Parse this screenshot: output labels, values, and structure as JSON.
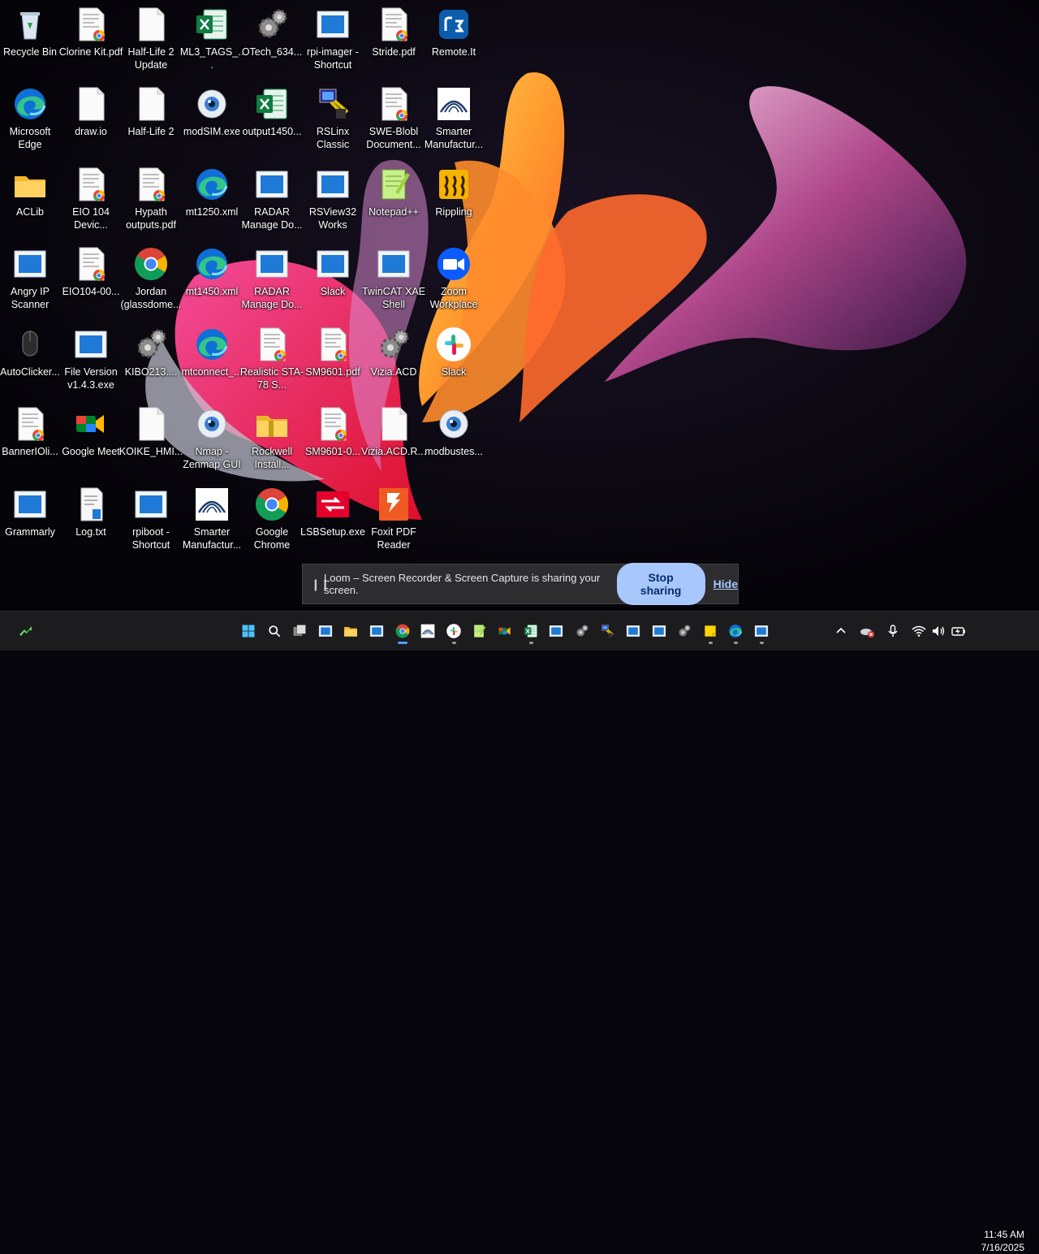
{
  "desktop": {
    "icons": [
      {
        "label": "Recycle Bin",
        "icon": "recycle-bin-icon",
        "col": 0,
        "row": 0
      },
      {
        "label": "Microsoft Edge",
        "icon": "edge-icon",
        "col": 0,
        "row": 1
      },
      {
        "label": "ACLib",
        "icon": "folder-icon",
        "col": 0,
        "row": 2
      },
      {
        "label": "Angry IP Scanner",
        "icon": "app-window-icon",
        "col": 0,
        "row": 3
      },
      {
        "label": "AutoClicker...",
        "icon": "mouse-icon",
        "col": 0,
        "row": 4
      },
      {
        "label": "BannerIOli...",
        "icon": "pdf-chrome-icon",
        "col": 0,
        "row": 5
      },
      {
        "label": "Grammarly",
        "icon": "app-window-icon",
        "col": 0,
        "row": 6
      },
      {
        "label": "Clorine Kit.pdf",
        "icon": "pdf-chrome-icon",
        "col": 1,
        "row": 0
      },
      {
        "label": "draw.io",
        "icon": "blank-file-icon",
        "col": 1,
        "row": 1
      },
      {
        "label": "EIO 104 Devic...",
        "icon": "pdf-chrome-icon",
        "col": 1,
        "row": 2
      },
      {
        "label": "EIO104-00...",
        "icon": "pdf-chrome-icon",
        "col": 1,
        "row": 3
      },
      {
        "label": "File Version v1.4.3.exe",
        "icon": "app-window-icon",
        "col": 1,
        "row": 4
      },
      {
        "label": "Google Meet",
        "icon": "google-meet-icon",
        "col": 1,
        "row": 5
      },
      {
        "label": "Log.txt",
        "icon": "text-file-icon",
        "col": 1,
        "row": 6
      },
      {
        "label": "Half-Life 2 Update",
        "icon": "blank-file-icon",
        "col": 2,
        "row": 0
      },
      {
        "label": "Half-Life 2",
        "icon": "blank-file-icon",
        "col": 2,
        "row": 1
      },
      {
        "label": "Hypath outputs.pdf",
        "icon": "pdf-chrome-icon",
        "col": 2,
        "row": 2
      },
      {
        "label": "Jordan (glassdome...",
        "icon": "chrome-icon",
        "col": 2,
        "row": 3
      },
      {
        "label": "KIBO213....",
        "icon": "gears-icon",
        "col": 2,
        "row": 4
      },
      {
        "label": "KOIKE_HMI...",
        "icon": "blank-file-icon",
        "col": 2,
        "row": 5
      },
      {
        "label": "rpiboot - Shortcut",
        "icon": "app-window-icon",
        "col": 2,
        "row": 6
      },
      {
        "label": "ML3_TAGS_...",
        "icon": "excel-icon",
        "col": 3,
        "row": 0
      },
      {
        "label": "modSIM.exe",
        "icon": "eye-icon",
        "col": 3,
        "row": 1
      },
      {
        "label": "mt1250.xml",
        "icon": "edge-icon",
        "col": 3,
        "row": 2
      },
      {
        "label": "mt1450.xml",
        "icon": "edge-icon",
        "col": 3,
        "row": 3
      },
      {
        "label": "mtconnect_...",
        "icon": "edge-icon",
        "col": 3,
        "row": 4
      },
      {
        "label": "Nmap - Zenmap GUI",
        "icon": "eye-icon",
        "col": 3,
        "row": 5
      },
      {
        "label": "Smarter Manufactur...",
        "icon": "arch-logo-icon",
        "col": 3,
        "row": 6
      },
      {
        "label": "OTech_634...",
        "icon": "gears-icon",
        "col": 4,
        "row": 0
      },
      {
        "label": "output1450...",
        "icon": "excel-icon",
        "col": 4,
        "row": 1
      },
      {
        "label": "RADAR Manage Do...",
        "icon": "app-window-icon",
        "col": 4,
        "row": 2
      },
      {
        "label": "RADAR Manage Do...",
        "icon": "app-window-icon",
        "col": 4,
        "row": 3
      },
      {
        "label": "Realistic STA-78 S...",
        "icon": "pdf-chrome-icon",
        "col": 4,
        "row": 4
      },
      {
        "label": "Rockwell Install...",
        "icon": "zip-folder-icon",
        "col": 4,
        "row": 5
      },
      {
        "label": "Google Chrome",
        "icon": "chrome-icon",
        "col": 4,
        "row": 6
      },
      {
        "label": "rpi-imager - Shortcut",
        "icon": "app-window-icon",
        "col": 5,
        "row": 0
      },
      {
        "label": "RSLinx Classic",
        "icon": "rslinx-icon",
        "col": 5,
        "row": 1
      },
      {
        "label": "RSView32 Works",
        "icon": "app-window-icon",
        "col": 5,
        "row": 2
      },
      {
        "label": "Slack",
        "icon": "app-window-icon",
        "col": 5,
        "row": 3
      },
      {
        "label": "SM9601.pdf",
        "icon": "pdf-chrome-icon",
        "col": 5,
        "row": 4
      },
      {
        "label": "SM9601-0...",
        "icon": "pdf-chrome-icon",
        "col": 5,
        "row": 5
      },
      {
        "label": "LSBSetup.exe",
        "icon": "lsb-icon",
        "col": 5,
        "row": 6
      },
      {
        "label": "Stride.pdf",
        "icon": "pdf-chrome-icon",
        "col": 6,
        "row": 0
      },
      {
        "label": "SWE-Blobl Document...",
        "icon": "pdf-chrome-icon",
        "col": 6,
        "row": 1
      },
      {
        "label": "Notepad++",
        "icon": "notepadpp-icon",
        "col": 6,
        "row": 2
      },
      {
        "label": "TwinCAT XAE Shell",
        "icon": "app-window-icon",
        "col": 6,
        "row": 3
      },
      {
        "label": "Vizia.ACD",
        "icon": "gears-icon",
        "col": 6,
        "row": 4
      },
      {
        "label": "Vizia.ACD.R...",
        "icon": "blank-file-icon",
        "col": 6,
        "row": 5
      },
      {
        "label": "Foxit PDF Reader",
        "icon": "foxit-icon",
        "col": 6,
        "row": 6
      },
      {
        "label": "Remote.It",
        "icon": "remoteit-icon",
        "col": 7,
        "row": 0
      },
      {
        "label": "Smarter Manufactur...",
        "icon": "arch-logo-icon",
        "col": 7,
        "row": 1
      },
      {
        "label": "Rippling",
        "icon": "rippling-icon",
        "col": 7,
        "row": 2
      },
      {
        "label": "Zoom Workplace",
        "icon": "zoom-icon",
        "col": 7,
        "row": 3
      },
      {
        "label": "Slack",
        "icon": "slack-icon",
        "col": 7,
        "row": 4
      },
      {
        "label": "modbustes...",
        "icon": "eye-icon",
        "col": 7,
        "row": 5
      }
    ]
  },
  "loom": {
    "message": "Loom – Screen Recorder & Screen Capture is sharing your screen.",
    "stop_label": "Stop sharing",
    "hide_label": "Hide"
  },
  "taskbar": {
    "apps": [
      {
        "icon": "windows-start-icon",
        "dot": "none"
      },
      {
        "icon": "search-icon",
        "dot": "none"
      },
      {
        "icon": "task-view-icon",
        "dot": "none"
      },
      {
        "icon": "app-window-icon",
        "dot": "none"
      },
      {
        "icon": "file-explorer-icon",
        "dot": "none"
      },
      {
        "icon": "app-window-icon",
        "dot": "none"
      },
      {
        "icon": "chrome-icon",
        "dot": "active"
      },
      {
        "icon": "arch-logo-icon",
        "dot": "none"
      },
      {
        "icon": "slack-icon",
        "dot": "open"
      },
      {
        "icon": "notepadpp-icon",
        "dot": "none"
      },
      {
        "icon": "google-meet-icon",
        "dot": "none"
      },
      {
        "icon": "excel-icon",
        "dot": "open"
      },
      {
        "icon": "app-window-icon",
        "dot": "none"
      },
      {
        "icon": "gears-icon",
        "dot": "none"
      },
      {
        "icon": "rslinx-icon",
        "dot": "none"
      },
      {
        "icon": "app-window-icon",
        "dot": "none"
      },
      {
        "icon": "app-window-icon",
        "dot": "none"
      },
      {
        "icon": "gears-icon",
        "dot": "none"
      },
      {
        "icon": "sticky-notes-icon",
        "dot": "open"
      },
      {
        "icon": "edge-icon",
        "dot": "open"
      },
      {
        "icon": "app-window-icon",
        "dot": "open"
      }
    ],
    "tray": {
      "time": "11:45 AM",
      "date": "7/16/2025"
    }
  }
}
